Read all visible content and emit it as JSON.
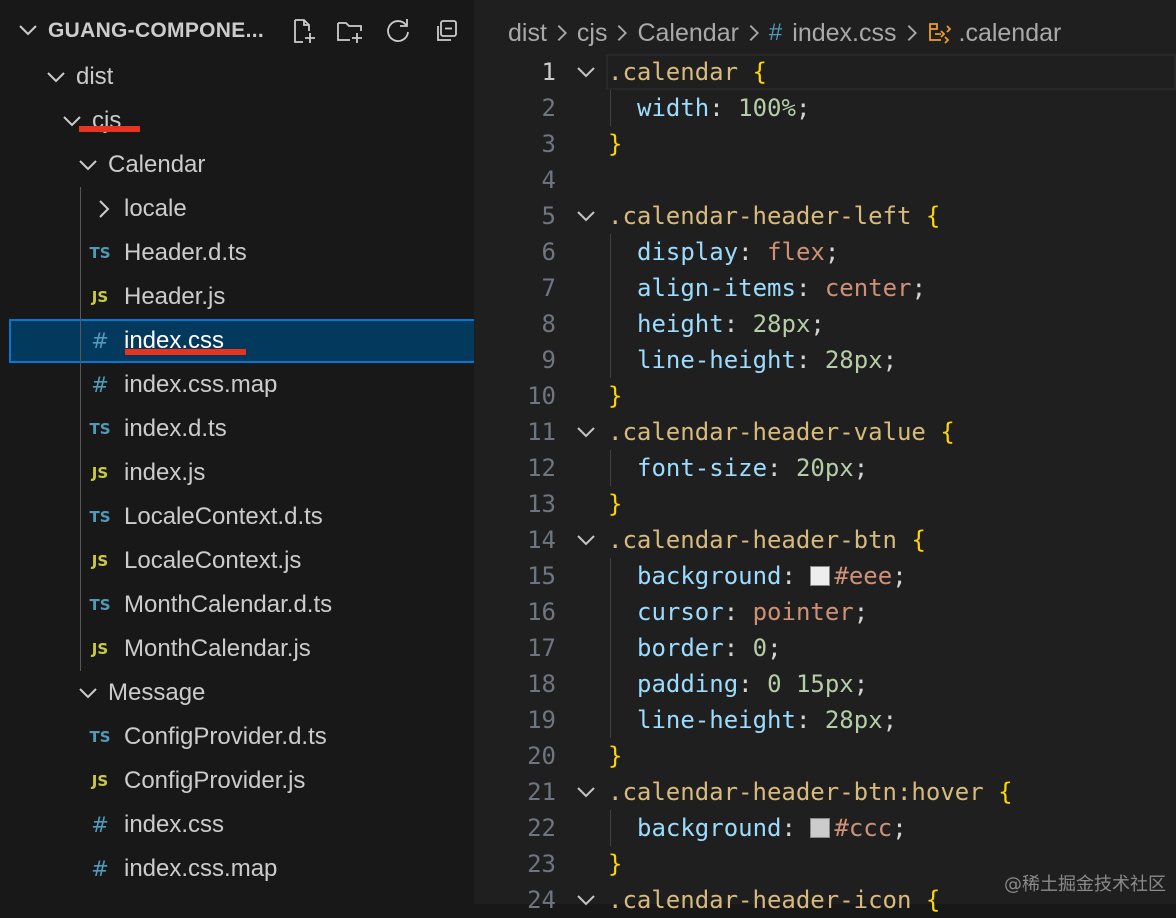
{
  "explorer": {
    "title": "GUANG-COMPONE...",
    "actions": [
      "new-file",
      "new-folder",
      "refresh",
      "collapse-all"
    ]
  },
  "tree": [
    {
      "label": "dist",
      "type": "folder",
      "expanded": true,
      "depth": 0
    },
    {
      "label": "cjs",
      "type": "folder",
      "expanded": true,
      "depth": 1
    },
    {
      "label": "Calendar",
      "type": "folder",
      "expanded": true,
      "depth": 2
    },
    {
      "label": "locale",
      "type": "folder",
      "expanded": false,
      "depth": 3
    },
    {
      "label": "Header.d.ts",
      "type": "ts",
      "icon_text": "TS",
      "depth": 3
    },
    {
      "label": "Header.js",
      "type": "js",
      "icon_text": "JS",
      "depth": 3
    },
    {
      "label": "index.css",
      "type": "css",
      "icon_text": "#",
      "depth": 3,
      "selected": true
    },
    {
      "label": "index.css.map",
      "type": "css",
      "icon_text": "#",
      "depth": 3
    },
    {
      "label": "index.d.ts",
      "type": "ts",
      "icon_text": "TS",
      "depth": 3
    },
    {
      "label": "index.js",
      "type": "js",
      "icon_text": "JS",
      "depth": 3
    },
    {
      "label": "LocaleContext.d.ts",
      "type": "ts",
      "icon_text": "TS",
      "depth": 3
    },
    {
      "label": "LocaleContext.js",
      "type": "js",
      "icon_text": "JS",
      "depth": 3
    },
    {
      "label": "MonthCalendar.d.ts",
      "type": "ts",
      "icon_text": "TS",
      "depth": 3
    },
    {
      "label": "MonthCalendar.js",
      "type": "js",
      "icon_text": "JS",
      "depth": 3
    },
    {
      "label": "Message",
      "type": "folder",
      "expanded": true,
      "depth": 2
    },
    {
      "label": "ConfigProvider.d.ts",
      "type": "ts",
      "icon_text": "TS",
      "depth": 3
    },
    {
      "label": "ConfigProvider.js",
      "type": "js",
      "icon_text": "JS",
      "depth": 3
    },
    {
      "label": "index.css",
      "type": "css",
      "icon_text": "#",
      "depth": 3
    },
    {
      "label": "index.css.map",
      "type": "css",
      "icon_text": "#",
      "depth": 3
    }
  ],
  "breadcrumb": {
    "items": [
      "dist",
      "cjs",
      "Calendar"
    ],
    "file_icon": "#",
    "file": "index.css",
    "symbol": ".calendar"
  },
  "editor": {
    "current_line": 1,
    "lines": [
      {
        "n": "1",
        "fold": true,
        "tokens": [
          [
            "sel",
            ".calendar "
          ],
          [
            "brace",
            "{"
          ]
        ]
      },
      {
        "n": "2",
        "indent": true,
        "tokens": [
          [
            "prop",
            "width"
          ],
          [
            "punc",
            ": "
          ],
          [
            "num",
            "100%"
          ],
          [
            "punc",
            ";"
          ]
        ]
      },
      {
        "n": "3",
        "tokens": [
          [
            "brace",
            "}"
          ]
        ]
      },
      {
        "n": "4",
        "tokens": []
      },
      {
        "n": "5",
        "fold": true,
        "tokens": [
          [
            "sel",
            ".calendar-header-left "
          ],
          [
            "brace",
            "{"
          ]
        ]
      },
      {
        "n": "6",
        "indent": true,
        "tokens": [
          [
            "prop",
            "display"
          ],
          [
            "punc",
            ": "
          ],
          [
            "val",
            "flex"
          ],
          [
            "punc",
            ";"
          ]
        ]
      },
      {
        "n": "7",
        "indent": true,
        "tokens": [
          [
            "prop",
            "align-items"
          ],
          [
            "punc",
            ": "
          ],
          [
            "val",
            "center"
          ],
          [
            "punc",
            ";"
          ]
        ]
      },
      {
        "n": "8",
        "indent": true,
        "tokens": [
          [
            "prop",
            "height"
          ],
          [
            "punc",
            ": "
          ],
          [
            "num",
            "28px"
          ],
          [
            "punc",
            ";"
          ]
        ]
      },
      {
        "n": "9",
        "indent": true,
        "tokens": [
          [
            "prop",
            "line-height"
          ],
          [
            "punc",
            ": "
          ],
          [
            "num",
            "28px"
          ],
          [
            "punc",
            ";"
          ]
        ]
      },
      {
        "n": "10",
        "tokens": [
          [
            "brace",
            "}"
          ]
        ]
      },
      {
        "n": "11",
        "fold": true,
        "tokens": [
          [
            "sel",
            ".calendar-header-value "
          ],
          [
            "brace",
            "{"
          ]
        ]
      },
      {
        "n": "12",
        "indent": true,
        "tokens": [
          [
            "prop",
            "font-size"
          ],
          [
            "punc",
            ": "
          ],
          [
            "num",
            "20px"
          ],
          [
            "punc",
            ";"
          ]
        ]
      },
      {
        "n": "13",
        "tokens": [
          [
            "brace",
            "}"
          ]
        ]
      },
      {
        "n": "14",
        "fold": true,
        "tokens": [
          [
            "sel",
            ".calendar-header-btn "
          ],
          [
            "brace",
            "{"
          ]
        ]
      },
      {
        "n": "15",
        "indent": true,
        "tokens": [
          [
            "prop",
            "background"
          ],
          [
            "punc",
            ": "
          ],
          [
            "swatch",
            "#eeeeee"
          ],
          [
            "val",
            "#eee"
          ],
          [
            "punc",
            ";"
          ]
        ]
      },
      {
        "n": "16",
        "indent": true,
        "tokens": [
          [
            "prop",
            "cursor"
          ],
          [
            "punc",
            ": "
          ],
          [
            "val",
            "pointer"
          ],
          [
            "punc",
            ";"
          ]
        ]
      },
      {
        "n": "17",
        "indent": true,
        "tokens": [
          [
            "prop",
            "border"
          ],
          [
            "punc",
            ": "
          ],
          [
            "num",
            "0"
          ],
          [
            "punc",
            ";"
          ]
        ]
      },
      {
        "n": "18",
        "indent": true,
        "tokens": [
          [
            "prop",
            "padding"
          ],
          [
            "punc",
            ": "
          ],
          [
            "num",
            "0 15px"
          ],
          [
            "punc",
            ";"
          ]
        ]
      },
      {
        "n": "19",
        "indent": true,
        "tokens": [
          [
            "prop",
            "line-height"
          ],
          [
            "punc",
            ": "
          ],
          [
            "num",
            "28px"
          ],
          [
            "punc",
            ";"
          ]
        ]
      },
      {
        "n": "20",
        "tokens": [
          [
            "brace",
            "}"
          ]
        ]
      },
      {
        "n": "21",
        "fold": true,
        "tokens": [
          [
            "sel",
            ".calendar-header-btn:hover "
          ],
          [
            "brace",
            "{"
          ]
        ]
      },
      {
        "n": "22",
        "indent": true,
        "tokens": [
          [
            "prop",
            "background"
          ],
          [
            "punc",
            ": "
          ],
          [
            "swatch",
            "#cccccc"
          ],
          [
            "val",
            "#ccc"
          ],
          [
            "punc",
            ";"
          ]
        ]
      },
      {
        "n": "23",
        "tokens": [
          [
            "brace",
            "}"
          ]
        ]
      },
      {
        "n": "24",
        "fold": true,
        "tokens": [
          [
            "sel",
            ".calendar-header-icon "
          ],
          [
            "brace",
            "{"
          ]
        ]
      }
    ]
  },
  "colors": {
    "annotation_red": "#e8331f",
    "selection_bg": "#04395e",
    "selection_border": "#0078d4"
  },
  "watermark": "@稀土掘金技术社区"
}
